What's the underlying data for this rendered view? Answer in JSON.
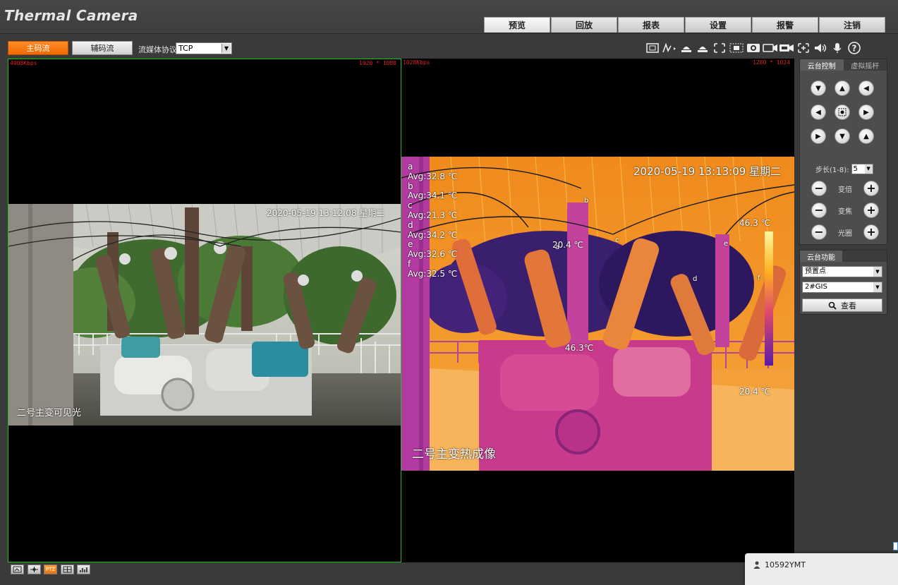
{
  "header": {
    "title": "Thermal Camera",
    "tabs": [
      {
        "label": "预览",
        "active": true
      },
      {
        "label": "回放"
      },
      {
        "label": "报表"
      },
      {
        "label": "设置"
      },
      {
        "label": "报警"
      },
      {
        "label": "注销"
      }
    ]
  },
  "toolbar": {
    "main_stream": "主码流",
    "sub_stream": "辅码流",
    "protocol_label": "流媒体协议",
    "protocol_value": "TCP",
    "icons": [
      "aspect-ratio-icon",
      "draw-icon",
      "flag-icon",
      "snapshot-icon",
      "record-icon",
      "zoom-region-icon",
      "region-select-icon",
      "screenshot-icon",
      "video-record-icon",
      "camera-alt-icon",
      "fit-icon",
      "volume-icon",
      "mic-icon",
      "help-icon"
    ]
  },
  "pane_visible": {
    "bitrate": "4008Kbps",
    "resolution": "1920 * 1080",
    "timestamp": "2020-05-19 13:12:08 星期二",
    "caption": "二号主变可见光"
  },
  "pane_thermal": {
    "bitrate": "1028Kbps",
    "resolution": "1280 * 1024",
    "timestamp": "2020-05-19 13:13:09 星期二",
    "caption": "二号主变热成像",
    "measurements": [
      {
        "name": "a",
        "avg": "Avg:32.8 ℃"
      },
      {
        "name": "b",
        "avg": "Avg:34.1 ℃"
      },
      {
        "name": "c",
        "avg": "Avg:21.3 ℃"
      },
      {
        "name": "d",
        "avg": "Avg:34.2 ℃"
      },
      {
        "name": "e",
        "avg": "Avg:32.6 ℃"
      },
      {
        "name": "f",
        "avg": "Avg:32.5 ℃"
      }
    ],
    "temp_points": [
      "46.3 ℃",
      "20.4 ℃",
      "46.3℃",
      "20.4 ℃"
    ],
    "markers": [
      "a",
      "b",
      "c",
      "d",
      "e",
      "f"
    ]
  },
  "ptz": {
    "tab_active": "云台控制",
    "tab_inactive": "虚拟摇杆",
    "step_label": "步长(1-8):",
    "step_value": "5",
    "zoom_label": "变倍",
    "focus_label": "变焦",
    "iris_label": "光圈"
  },
  "ptz_function": {
    "title": "云台功能",
    "function_value": "预置点",
    "preset_value": "2#GIS",
    "view_button": "查看"
  },
  "bottom": {
    "icons": [
      "fullscreen-icon",
      "layout-icon",
      "PTZ",
      "grid-icon",
      "stats-icon"
    ],
    "ptz_label": "PTZ"
  },
  "user": {
    "name": "10592YMT"
  }
}
